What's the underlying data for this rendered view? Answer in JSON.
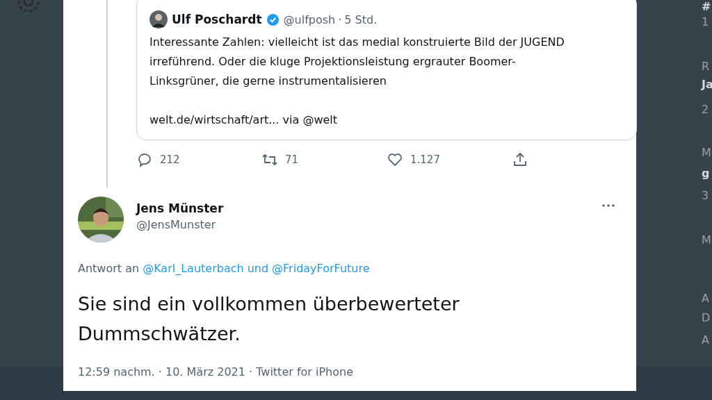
{
  "quoted_tweet": {
    "name": "Ulf Poschardt",
    "verified": true,
    "handle": "@ulfposh",
    "separator": "·",
    "time": "5 Std.",
    "text": "Interessante Zahlen: vielleicht ist das medial konstruierte Bild der JUGEND irreführend. Oder die kluge Projektionsleistung ergrauter Boomer-Linksgrüner, die gerne instrumentalisieren",
    "link": "welt.de/wirtschaft/art... via @welt"
  },
  "actions": [
    {
      "kind": "reply",
      "count": "212"
    },
    {
      "kind": "retweet",
      "count": "71"
    },
    {
      "kind": "like",
      "count": "1.127"
    },
    {
      "kind": "share"
    }
  ],
  "tweet": {
    "name": "Jens Münster",
    "handle": "@JensMunster",
    "reply_prefix": "Antwort an",
    "reply_to": [
      "@Karl_Lauterbach",
      "@FridayForFuture"
    ],
    "reply_joiner": "und",
    "text": "Sie sind ein vollkommen überbewerteter Dummschwätzer.",
    "footer": "12:59 nachm. · 10. März 2021 · Twitter for iPhone"
  },
  "side_fragments": [
    {
      "text": "#",
      "bold": true
    },
    {
      "text": "1",
      "bold": false
    },
    {
      "text": "R",
      "bold": false
    },
    {
      "text": "Ja",
      "bold": true
    },
    {
      "text": "2",
      "bold": false
    },
    {
      "text": "M",
      "bold": false
    },
    {
      "text": "g",
      "bold": true
    },
    {
      "text": "3",
      "bold": false
    },
    {
      "text": "M",
      "bold": false
    },
    {
      "text": "A",
      "bold": false
    },
    {
      "text": "D",
      "bold": false
    },
    {
      "text": "A",
      "bold": false
    }
  ]
}
